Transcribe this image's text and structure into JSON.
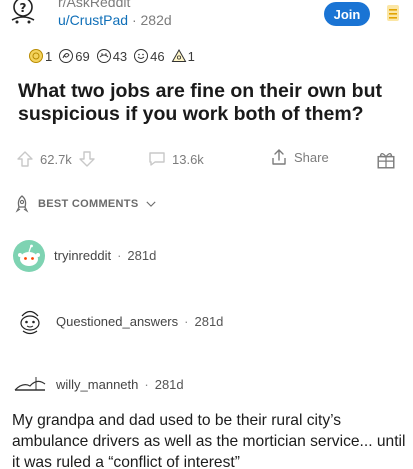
{
  "post": {
    "subreddit": "r/AskReddit",
    "author": "u/CrustPad",
    "age": "282d",
    "join_label": "Join",
    "title": "What two jobs are fine on their own but suspicious if you work both of them?"
  },
  "awards": [
    {
      "icon": "gold-award-icon",
      "count": "1"
    },
    {
      "icon": "snake-award-icon",
      "count": "69"
    },
    {
      "icon": "hug-award-icon",
      "count": "43"
    },
    {
      "icon": "wholesome-award-icon",
      "count": "46"
    },
    {
      "icon": "triangle-award-icon",
      "count": "1"
    }
  ],
  "actions": {
    "votes": "62.7k",
    "comments": "13.6k",
    "share": "Share"
  },
  "sort": {
    "label": "BEST COMMENTS"
  },
  "comments": [
    {
      "user": "tryinreddit",
      "age": "281d"
    },
    {
      "user": "Questioned_answers",
      "age": "281d"
    },
    {
      "user": "willy_manneth",
      "age": "281d",
      "body": "My grandpa and dad used to be their rural city’s ambulance drivers as well as the mortician service... until it was ruled a “conflict of interest”"
    }
  ],
  "colors": {
    "accent": "#1a74d4",
    "username_link": "#0f6fb8",
    "meta_text": "#7c7c7c",
    "snoo_avatar_bg": "#7ed3b2"
  }
}
